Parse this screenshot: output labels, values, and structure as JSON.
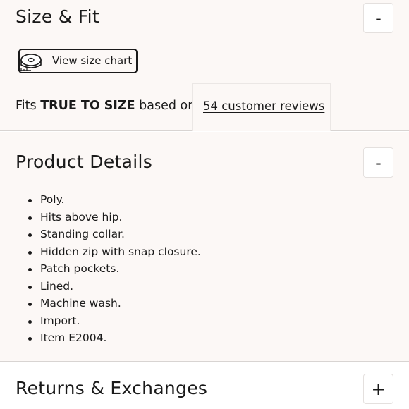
{
  "size_fit": {
    "title": "Size & Fit",
    "toggle": "-",
    "size_chart_label": "View size chart",
    "fit_prefix": "Fits",
    "fit_value": "TRUE TO SIZE",
    "fit_suffix": "based on",
    "reviews_link": "54 customer reviews"
  },
  "product_details": {
    "title": "Product Details",
    "toggle": "-",
    "items": [
      "Poly.",
      "Hits above hip.",
      "Standing collar.",
      "Hidden zip with snap closure.",
      "Patch pockets.",
      "Lined.",
      "Machine wash.",
      "Import.",
      "Item E2004."
    ]
  },
  "returns": {
    "title": "Returns & Exchanges",
    "toggle": "+"
  },
  "icons": {
    "size_chart": "measuring-tape-icon"
  },
  "colors": {
    "panel_bg": "#fcf8f6",
    "text": "#1a1a1a",
    "divider": "#d8d4d2"
  }
}
